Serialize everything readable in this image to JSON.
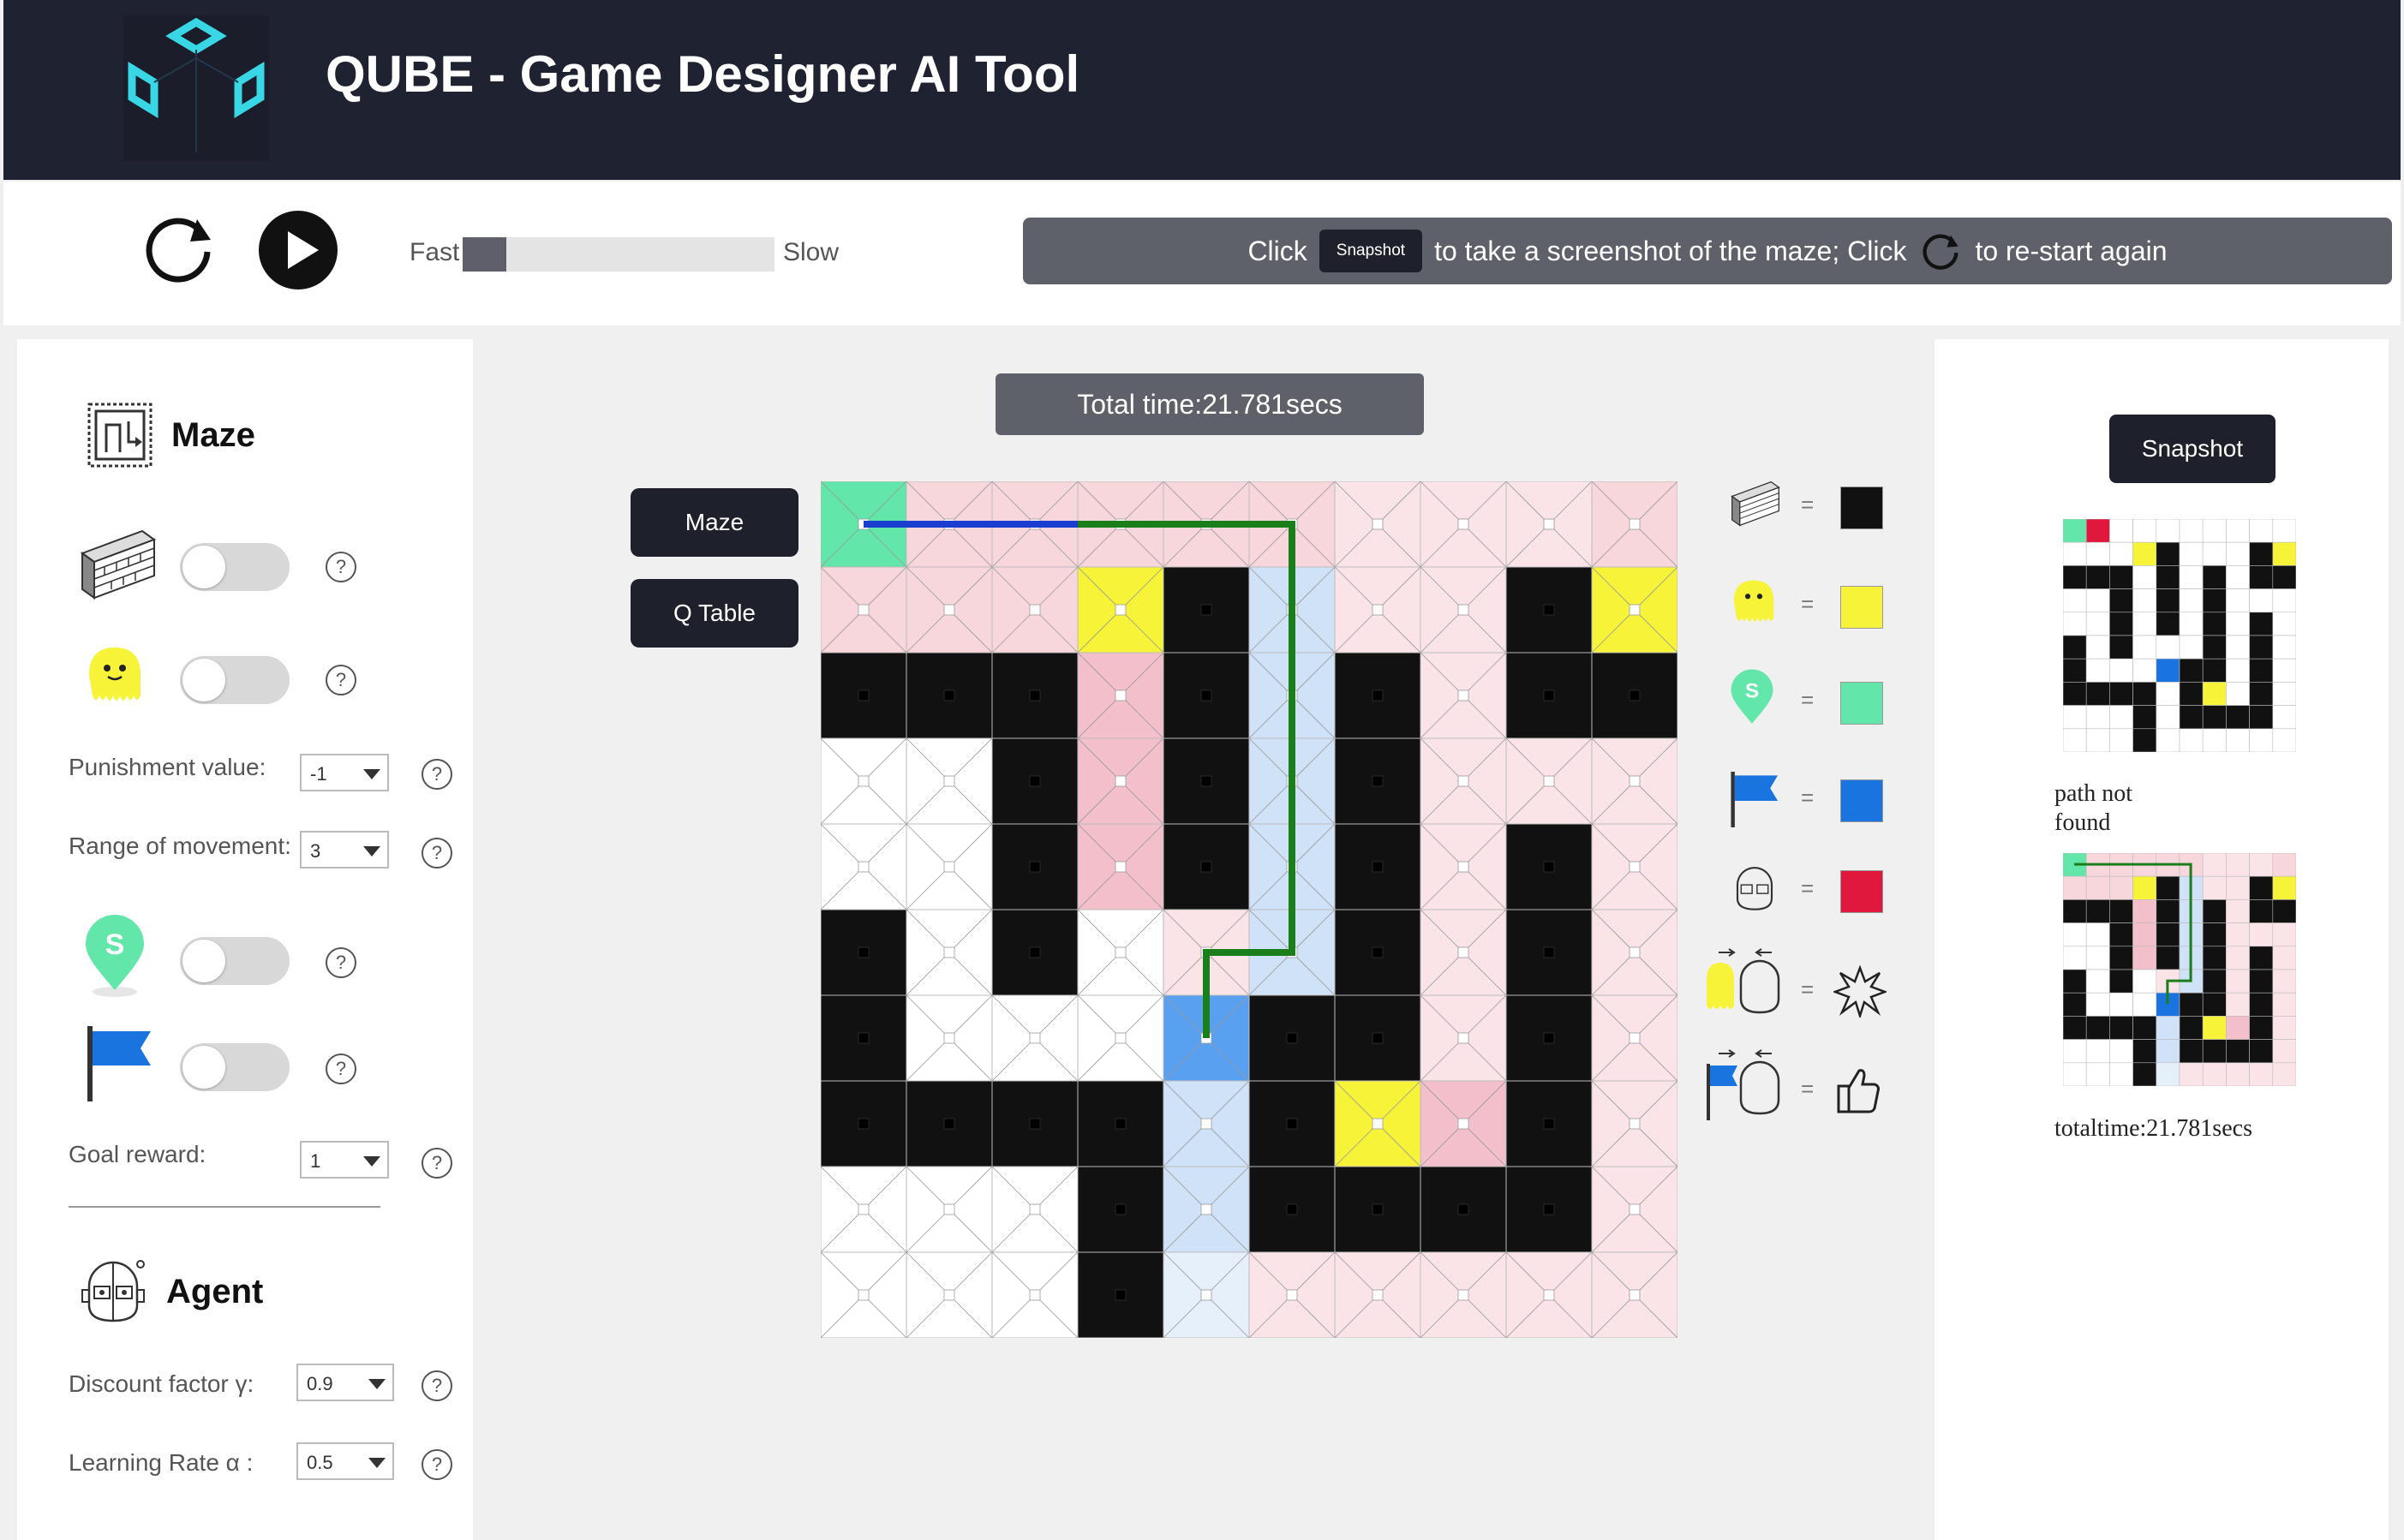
{
  "app": {
    "title": "QUBE - Game Designer AI Tool"
  },
  "toolbar": {
    "speed_fast": "Fast",
    "speed_slow": "Slow",
    "speed_value": 0.14,
    "instr_click1": "Click",
    "instr_chip": "Snapshot",
    "instr_mid": "to take a screenshot of the maze; Click",
    "instr_end": "to re-start again"
  },
  "maze_panel": {
    "title": "Maze",
    "punishment_label": "Punishment value:",
    "punishment_value": "-1",
    "range_label": "Range of movement:",
    "range_value": "3",
    "goal_label": "Goal reward:",
    "goal_value": "1",
    "help": "?"
  },
  "agent_panel": {
    "title": "Agent",
    "discount_label": "Discount factor γ:",
    "discount_value": "0.9",
    "lr_label": "Learning Rate α :",
    "lr_value": "0.5"
  },
  "center": {
    "total_time": "Total time:21.781secs",
    "maze_button": "Maze",
    "qtable_button": "Q Table"
  },
  "legend": {
    "eq": "="
  },
  "right": {
    "snapshot_button": "Snapshot",
    "path_status": "path not found",
    "total_time": "totaltime:21.781secs"
  },
  "colors": {
    "wall": "#111111",
    "monster": "#f6f339",
    "start": "#63e6a9",
    "goal": "#1a74e0",
    "agent": "#e0183e",
    "path": "#1a7f1a"
  },
  "icons": [
    "refresh-icon",
    "play-icon",
    "logo-cube-icon",
    "maze-icon",
    "brick-wall-icon",
    "monster-icon",
    "start-pin-icon",
    "goal-flag-icon",
    "agent-robot-icon",
    "collision-icon",
    "thumbs-up-icon"
  ]
}
